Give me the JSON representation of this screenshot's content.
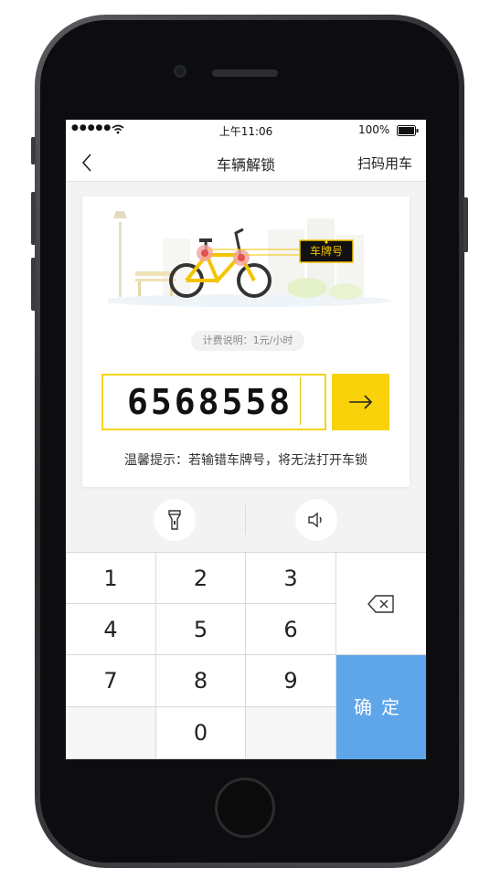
{
  "status_bar": {
    "signal": "●●●●●",
    "time": "上午11:06",
    "battery_percent": "100%"
  },
  "nav": {
    "back_icon": "chevron-left-icon",
    "title": "车辆解锁",
    "right_action": "扫码用车"
  },
  "card": {
    "plate_sign_label": "车牌号",
    "fee_info": "计费说明：1元/小时",
    "plate_number": "6568558",
    "submit_icon": "arrow-right-icon",
    "tip": "温馨提示：若输错车牌号，将无法打开车锁"
  },
  "tools": {
    "left_icon": "flashlight-icon",
    "right_icon": "speaker-icon"
  },
  "keypad": {
    "keys": [
      "1",
      "2",
      "3",
      "4",
      "5",
      "6",
      "7",
      "8",
      "9",
      "0"
    ],
    "delete_icon": "backspace-icon",
    "confirm_label": "确定"
  },
  "colors": {
    "accent_yellow": "#f9d20a",
    "confirm_blue": "#5ea5ea"
  }
}
